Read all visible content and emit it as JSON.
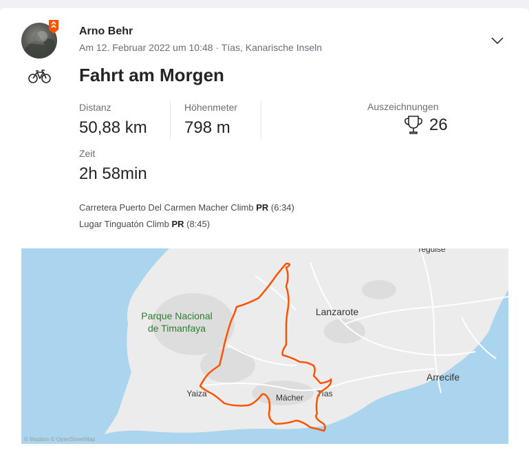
{
  "athlete": {
    "name": "Arno Behr",
    "date": "Am 12. Februar 2022 um 10:48",
    "separator": "·",
    "location": "Tías, Kanarische Inseln"
  },
  "activity": {
    "sport_icon": "bicycle-icon",
    "title": "Fahrt am Morgen"
  },
  "stats": {
    "distance": {
      "label": "Distanz",
      "value": "50,88 km"
    },
    "elevation": {
      "label": "Höhenmeter",
      "value": "798 m"
    },
    "time": {
      "label": "Zeit",
      "value": "2h 58min"
    },
    "achievements": {
      "label": "Auszeichnungen",
      "value": "26",
      "icon": "trophy-icon"
    }
  },
  "segments": [
    {
      "name": "Carretera Puerto Del Carmen Macher Climb",
      "badge": "PR",
      "time": "(6:34)"
    },
    {
      "name": "Lugar Tinguatón Climb",
      "badge": "PR",
      "time": "(8:45)"
    }
  ],
  "map": {
    "labels": {
      "park_line1": "Parque Nacional",
      "park_line2": "de Timanfaya",
      "island": "Lanzarote",
      "arrecife": "Arrecife",
      "yaiza": "Yaiza",
      "macher": "Mácher",
      "tias": "Tías",
      "teguise": "Teguise"
    },
    "attribution": "© Mapbox © OpenStreetMap",
    "colors": {
      "route": "#fc5200",
      "sea": "#abd4ee",
      "land": "#ececec",
      "park_label": "#2e7d32"
    }
  },
  "colors": {
    "brand": "#fc5200",
    "text": "#242428",
    "muted": "#6d6d78"
  }
}
